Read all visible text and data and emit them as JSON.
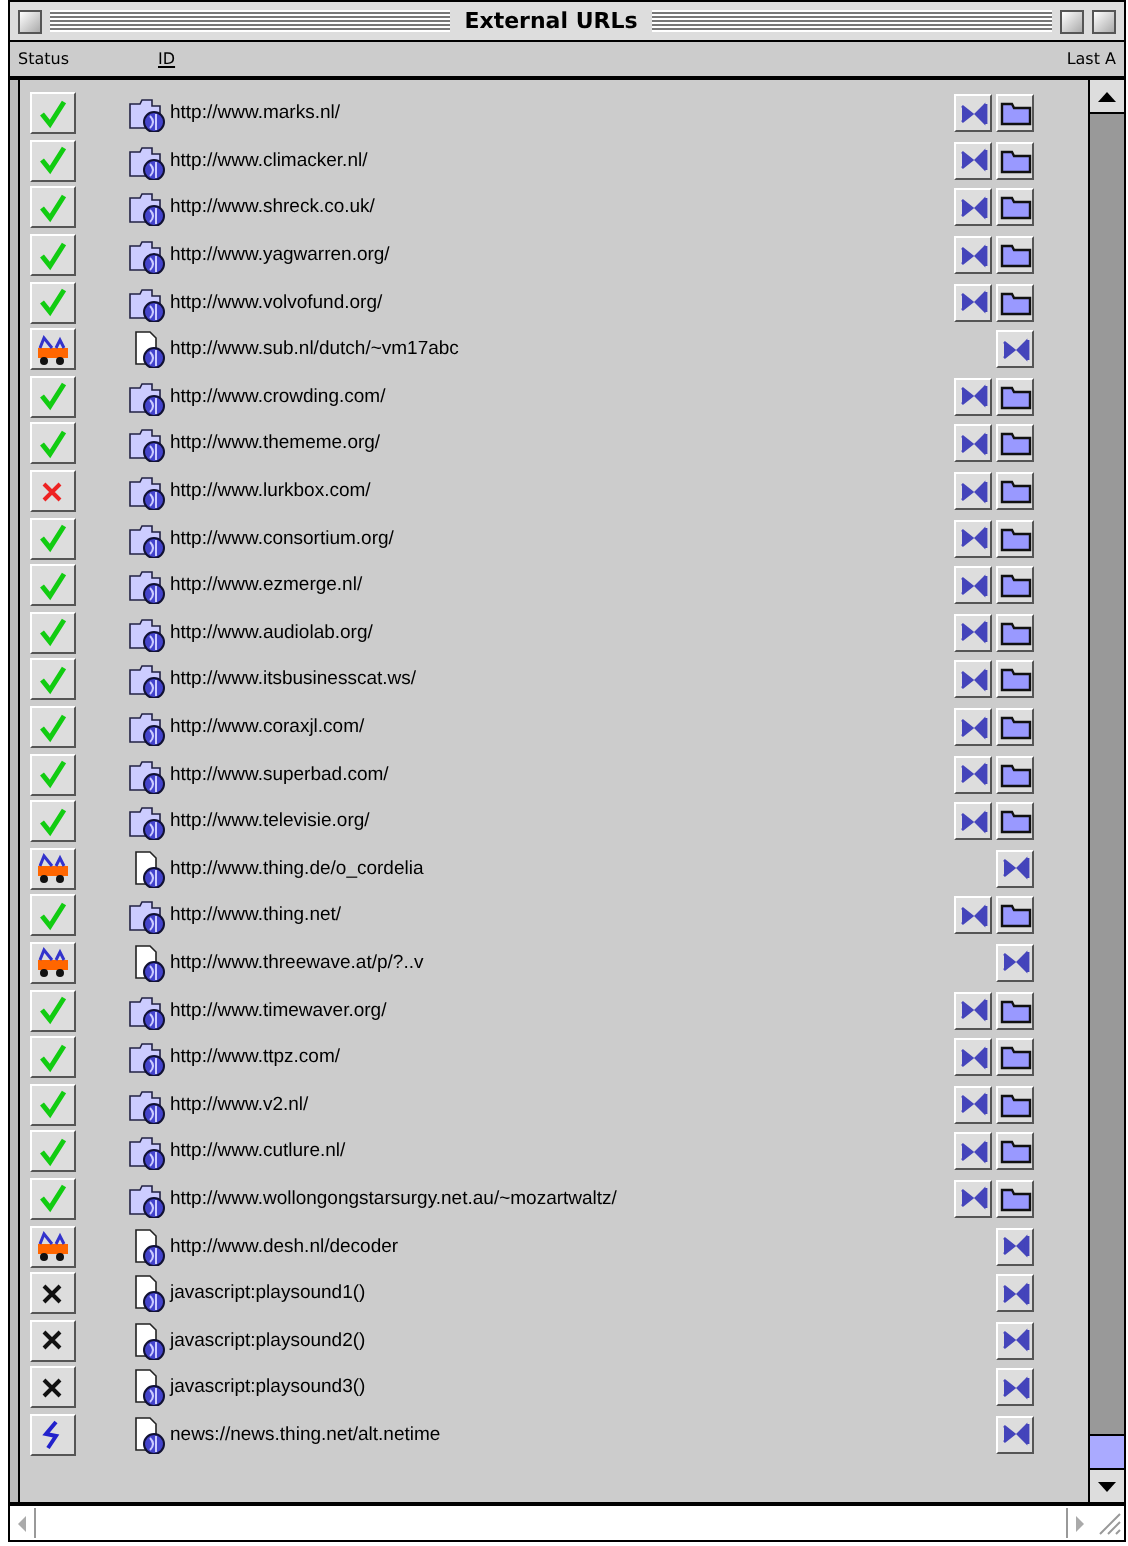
{
  "window": {
    "title": "External URLs"
  },
  "columns": [
    {
      "label": "Status",
      "sorted": false
    },
    {
      "label": "ID",
      "sorted": true
    },
    {
      "label": "Last A",
      "sorted": false
    }
  ],
  "rows": [
    {
      "status": {
        "kind": "ok"
      },
      "file": {
        "kind": "folder"
      },
      "url": "http://www.marks.nl/",
      "folder_button": true
    },
    {
      "status": {
        "kind": "ok"
      },
      "file": {
        "kind": "folder"
      },
      "url": "http://www.climacker.nl/",
      "folder_button": true
    },
    {
      "status": {
        "kind": "ok"
      },
      "file": {
        "kind": "folder"
      },
      "url": "http://www.shreck.co.uk/",
      "folder_button": true
    },
    {
      "status": {
        "kind": "ok"
      },
      "file": {
        "kind": "folder"
      },
      "url": "http://www.yagwarren.org/",
      "folder_button": true
    },
    {
      "status": {
        "kind": "ok"
      },
      "file": {
        "kind": "folder"
      },
      "url": "http://www.volvofund.org/",
      "folder_button": true
    },
    {
      "status": {
        "kind": "busy"
      },
      "file": {
        "kind": "document"
      },
      "url": "http://www.sub.nl/dutch/~vm17abc",
      "folder_button": false
    },
    {
      "status": {
        "kind": "ok"
      },
      "file": {
        "kind": "folder"
      },
      "url": "http://www.crowding.com/",
      "folder_button": true
    },
    {
      "status": {
        "kind": "ok"
      },
      "file": {
        "kind": "folder"
      },
      "url": "http://www.thememe.org/",
      "folder_button": true
    },
    {
      "status": {
        "kind": "error"
      },
      "file": {
        "kind": "folder"
      },
      "url": "http://www.lurkbox.com/",
      "folder_button": true
    },
    {
      "status": {
        "kind": "ok"
      },
      "file": {
        "kind": "folder"
      },
      "url": "http://www.consortium.org/",
      "folder_button": true
    },
    {
      "status": {
        "kind": "ok"
      },
      "file": {
        "kind": "folder"
      },
      "url": "http://www.ezmerge.nl/",
      "folder_button": true
    },
    {
      "status": {
        "kind": "ok"
      },
      "file": {
        "kind": "folder"
      },
      "url": "http://www.audiolab.org/",
      "folder_button": true
    },
    {
      "status": {
        "kind": "ok"
      },
      "file": {
        "kind": "folder"
      },
      "url": "http://www.itsbusinesscat.ws/",
      "folder_button": true
    },
    {
      "status": {
        "kind": "ok"
      },
      "file": {
        "kind": "folder"
      },
      "url": "http://www.coraxjl.com/",
      "folder_button": true
    },
    {
      "status": {
        "kind": "ok"
      },
      "file": {
        "kind": "folder"
      },
      "url": "http://www.superbad.com/",
      "folder_button": true
    },
    {
      "status": {
        "kind": "ok"
      },
      "file": {
        "kind": "folder"
      },
      "url": "http://www.televisie.org/",
      "folder_button": true
    },
    {
      "status": {
        "kind": "busy"
      },
      "file": {
        "kind": "document"
      },
      "url": "http://www.thing.de/o_cordelia",
      "folder_button": false
    },
    {
      "status": {
        "kind": "ok"
      },
      "file": {
        "kind": "folder"
      },
      "url": "http://www.thing.net/",
      "folder_button": true
    },
    {
      "status": {
        "kind": "busy"
      },
      "file": {
        "kind": "document"
      },
      "url": "http://www.threewave.at/p/?..v",
      "folder_button": false
    },
    {
      "status": {
        "kind": "ok"
      },
      "file": {
        "kind": "folder"
      },
      "url": "http://www.timewaver.org/",
      "folder_button": true
    },
    {
      "status": {
        "kind": "ok"
      },
      "file": {
        "kind": "folder"
      },
      "url": "http://www.ttpz.com/",
      "folder_button": true
    },
    {
      "status": {
        "kind": "ok"
      },
      "file": {
        "kind": "folder"
      },
      "url": "http://www.v2.nl/",
      "folder_button": true
    },
    {
      "status": {
        "kind": "ok"
      },
      "file": {
        "kind": "folder"
      },
      "url": "http://www.cutlure.nl/",
      "folder_button": true
    },
    {
      "status": {
        "kind": "ok"
      },
      "file": {
        "kind": "folder"
      },
      "url": "http://www.wollongongstarsurgy.net.au/~mozartwaltz/",
      "folder_button": true
    },
    {
      "status": {
        "kind": "busy"
      },
      "file": {
        "kind": "document"
      },
      "url": "http://www.desh.nl/decoder",
      "folder_button": false
    },
    {
      "status": {
        "kind": "skipped"
      },
      "file": {
        "kind": "document"
      },
      "url": "javascript:playsound1()",
      "folder_button": false
    },
    {
      "status": {
        "kind": "skipped"
      },
      "file": {
        "kind": "document"
      },
      "url": "javascript:playsound2()",
      "folder_button": false
    },
    {
      "status": {
        "kind": "skipped"
      },
      "file": {
        "kind": "document"
      },
      "url": "javascript:playsound3()",
      "folder_button": false
    },
    {
      "status": {
        "kind": "news"
      },
      "file": {
        "kind": "document"
      },
      "url": "news://news.thing.net/alt.netime",
      "folder_button": false
    }
  ]
}
